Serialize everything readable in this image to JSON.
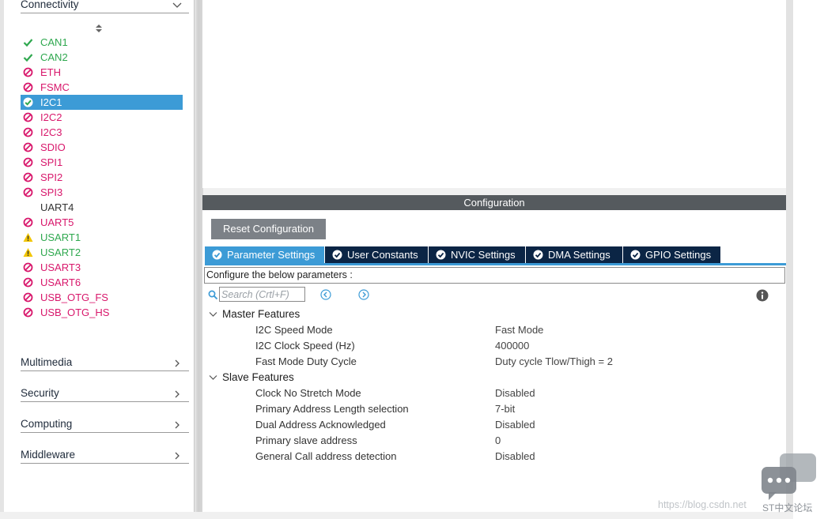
{
  "sidebar": {
    "categories": {
      "connectivity": "Connectivity",
      "multimedia": "Multimedia",
      "security": "Security",
      "computing": "Computing",
      "middleware": "Middleware"
    },
    "peripherals": [
      {
        "label": "CAN1",
        "status": "ok"
      },
      {
        "label": "CAN2",
        "status": "ok"
      },
      {
        "label": "ETH",
        "status": "disabled"
      },
      {
        "label": "FSMC",
        "status": "disabled"
      },
      {
        "label": "I2C1",
        "status": "ok-selected"
      },
      {
        "label": "I2C2",
        "status": "disabled"
      },
      {
        "label": "I2C3",
        "status": "disabled"
      },
      {
        "label": "SDIO",
        "status": "disabled"
      },
      {
        "label": "SPI1",
        "status": "disabled"
      },
      {
        "label": "SPI2",
        "status": "disabled"
      },
      {
        "label": "SPI3",
        "status": "disabled"
      },
      {
        "label": "UART4",
        "status": "none"
      },
      {
        "label": "UART5",
        "status": "disabled"
      },
      {
        "label": "USART1",
        "status": "warning"
      },
      {
        "label": "USART2",
        "status": "warning"
      },
      {
        "label": "USART3",
        "status": "disabled"
      },
      {
        "label": "USART6",
        "status": "disabled"
      },
      {
        "label": "USB_OTG_FS",
        "status": "disabled"
      },
      {
        "label": "USB_OTG_HS",
        "status": "disabled"
      }
    ]
  },
  "config": {
    "header": "Configuration",
    "reset_label": "Reset Configuration",
    "tabs": [
      {
        "label": "Parameter Settings",
        "active": true
      },
      {
        "label": "User Constants",
        "active": false
      },
      {
        "label": "NVIC Settings",
        "active": false
      },
      {
        "label": "DMA Settings",
        "active": false
      },
      {
        "label": "GPIO Settings",
        "active": false
      }
    ],
    "description": "Configure the below parameters :",
    "search_placeholder": "Search (Crtl+F)",
    "groups": {
      "master": {
        "title": "Master Features",
        "params": [
          {
            "name": "I2C Speed Mode",
            "value": "Fast Mode"
          },
          {
            "name": "I2C Clock Speed (Hz)",
            "value": "400000"
          },
          {
            "name": "Fast Mode Duty Cycle",
            "value": "Duty cycle Tlow/Thigh = 2"
          }
        ]
      },
      "slave": {
        "title": "Slave Features",
        "params": [
          {
            "name": "Clock No Stretch Mode",
            "value": "Disabled"
          },
          {
            "name": "Primary Address Length selection",
            "value": "7-bit"
          },
          {
            "name": "Dual Address Acknowledged",
            "value": "Disabled"
          },
          {
            "name": "Primary slave address",
            "value": "0"
          },
          {
            "name": "General Call address detection",
            "value": "Disabled"
          }
        ]
      }
    }
  },
  "watermark": {
    "url": "https://blog.csdn.net",
    "brand": "ST中文论坛"
  },
  "colors": {
    "ok": "#2fa84f",
    "disabled": "#d8176b",
    "warning": "#f2c500",
    "accent": "#3c9bd6",
    "tab_dark": "#0b2545"
  }
}
